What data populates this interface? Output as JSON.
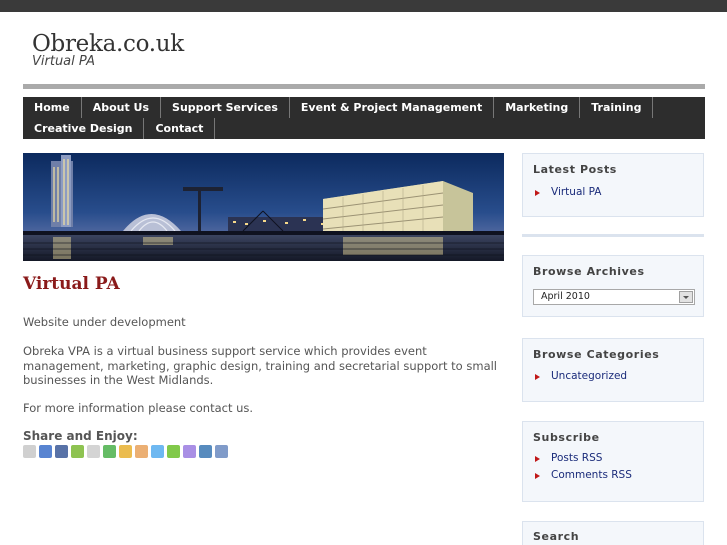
{
  "site": {
    "title": "Obreka.co.uk",
    "tagline": "Virtual PA"
  },
  "nav": {
    "items_row1": [
      "Home",
      "About Us",
      "Support Services",
      "Event & Project Management",
      "Marketing",
      "Training"
    ],
    "items_row2": [
      "Creative Design",
      "Contact"
    ]
  },
  "post": {
    "title": "Virtual PA",
    "paragraphs": [
      "Website under development",
      "Obreka VPA is a virtual business support service which provides event management, marketing, graphic design, training and secretarial support to small businesses in the West Midlands.",
      "For more information please contact us."
    ],
    "share_title": "Share and Enjoy:",
    "share_icons": [
      {
        "name": "digg-icon",
        "color": "#c8c8c8"
      },
      {
        "name": "delicious-icon",
        "color": "#3b6fc9"
      },
      {
        "name": "facebook-icon",
        "color": "#3b5998"
      },
      {
        "name": "evernote-icon",
        "color": "#7ab833"
      },
      {
        "name": "reddit-icon",
        "color": "#cccccc"
      },
      {
        "name": "stumbleupon-icon",
        "color": "#4ab04a"
      },
      {
        "name": "google-icon",
        "color": "#e8b030"
      },
      {
        "name": "blogger-icon",
        "color": "#e8a15a"
      },
      {
        "name": "twitter-icon",
        "color": "#55acee"
      },
      {
        "name": "technorati-icon",
        "color": "#6bbf2a"
      },
      {
        "name": "yahoo-buzz-icon",
        "color": "#9a7be0"
      },
      {
        "name": "linkedin-icon",
        "color": "#3a77b3"
      },
      {
        "name": "email-icon",
        "color": "#6a8ac0"
      }
    ]
  },
  "sidebar": {
    "latest_posts": {
      "title": "Latest Posts",
      "items": [
        "Virtual PA"
      ]
    },
    "archives": {
      "title": "Browse Archives",
      "selected": "April 2010"
    },
    "categories": {
      "title": "Browse Categories",
      "items": [
        "Uncategorized"
      ]
    },
    "subscribe": {
      "title": "Subscribe",
      "items": [
        "Posts RSS",
        "Comments RSS"
      ]
    },
    "search": {
      "title": "Search"
    }
  },
  "colors": {
    "topbar": "#3a3a3a",
    "nav_bg": "#2d2d2d",
    "post_title": "#8a1a1a",
    "link": "#1a2b7a",
    "bullet": "#c01818"
  }
}
